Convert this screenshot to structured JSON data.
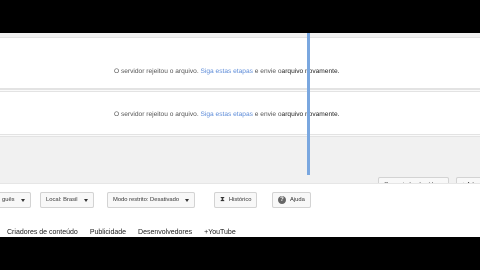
{
  "upload_rows": [
    {
      "message_prefix": "O servidor rejeitou o arquivo.",
      "link_text": "Siga estas etapas",
      "message_suffix_a": "e envie o",
      "message_suffix_b": "arquivo novamente."
    },
    {
      "message_prefix": "O servidor rejeitou o arquivo.",
      "link_text": "Siga estas etapas",
      "message_suffix_a": "e envie o",
      "message_suffix_b": "arquivo novamente."
    }
  ],
  "toolbar": {
    "video_manager_label": "Gerenciador de vídeos",
    "add_label": "+ Ad"
  },
  "footer": {
    "language_label": "guês",
    "location_label": "Local: Brasil",
    "restricted_mode_label": "Modo restrito: Desativado",
    "history_label": "Histórico",
    "help_label": "Ajuda",
    "links": [
      "Criadores de conteúdo",
      "Publicidade",
      "Desenvolvedores",
      "+YouTube"
    ]
  },
  "colors": {
    "link": "#5c8bd8",
    "drag_frame": "#7aa7df"
  },
  "icons": {
    "history": "hourglass-icon",
    "help": "help-circle-icon",
    "dropdown": "caret-down-icon"
  }
}
